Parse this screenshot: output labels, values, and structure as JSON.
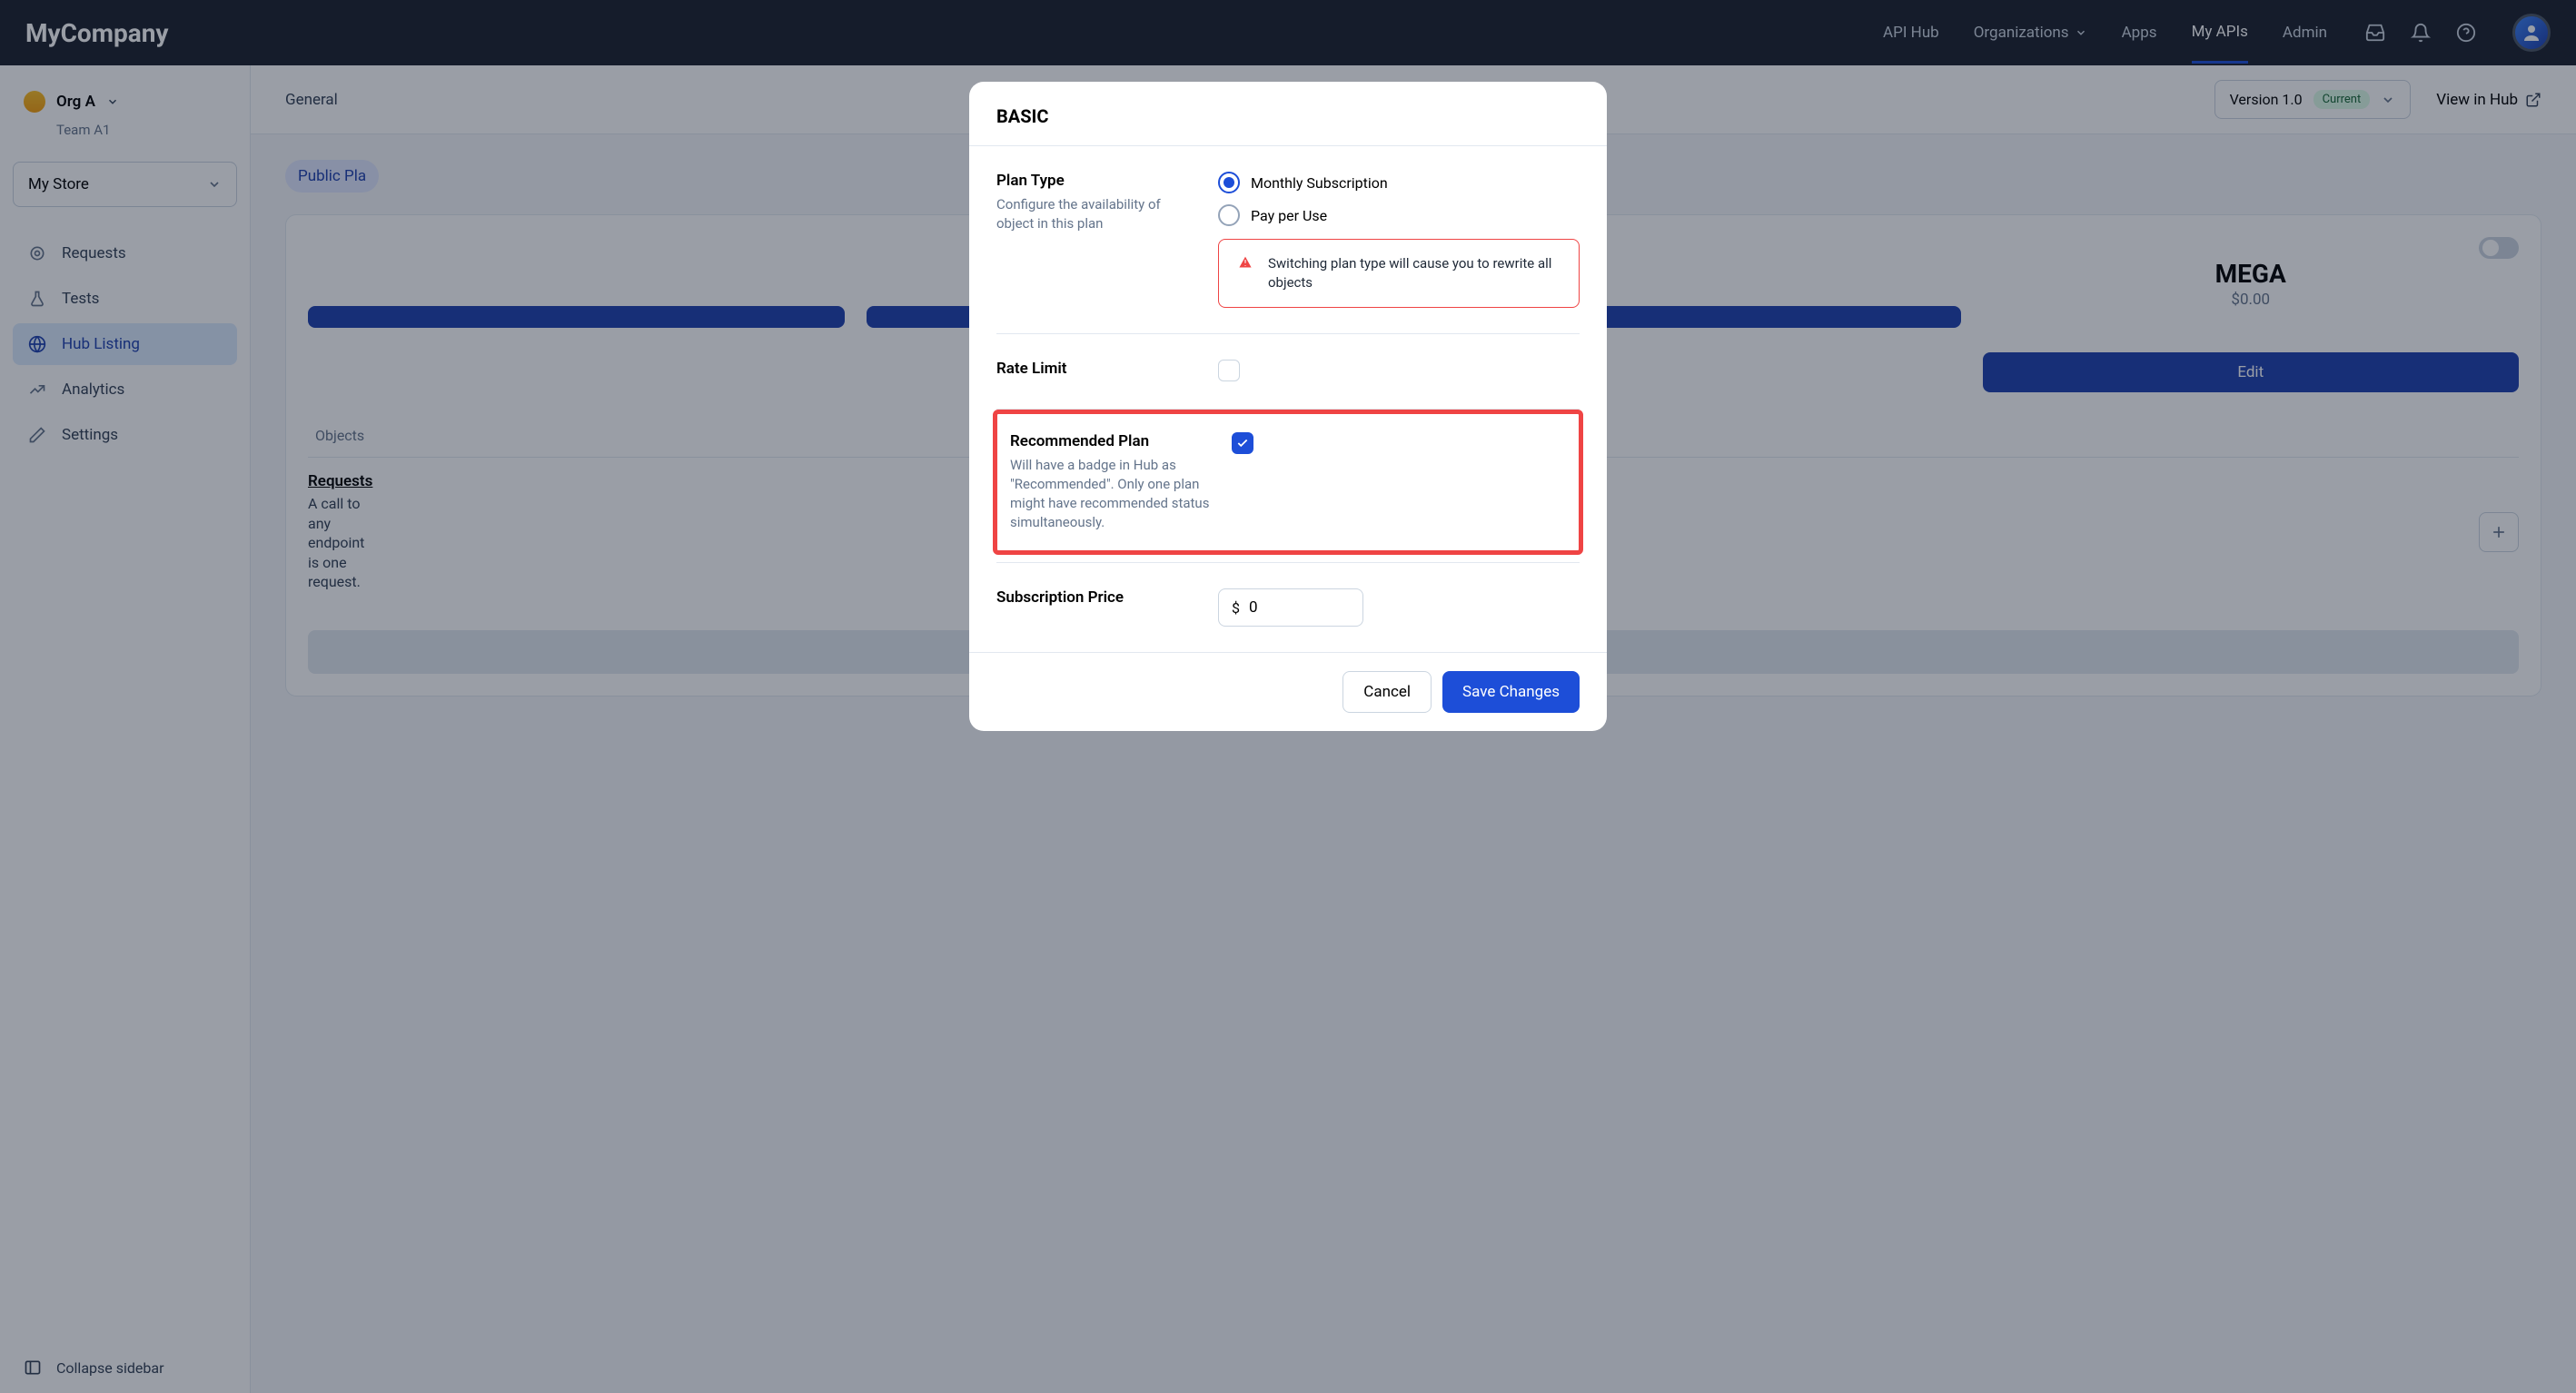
{
  "topnav": {
    "logo": "MyCompany",
    "links": {
      "api_hub": "API Hub",
      "organizations": "Organizations",
      "apps": "Apps",
      "my_apis": "My APIs",
      "admin": "Admin"
    }
  },
  "sidebar": {
    "org_name": "Org A",
    "team_name": "Team A1",
    "store_select": "My Store",
    "items": {
      "requests": "Requests",
      "tests": "Tests",
      "hub_listing": "Hub Listing",
      "analytics": "Analytics",
      "settings": "Settings"
    },
    "collapse": "Collapse sidebar"
  },
  "main": {
    "tabs": {
      "general": "General"
    },
    "version": {
      "label": "Version 1.0",
      "badge": "Current"
    },
    "view_hub": "View in Hub",
    "public_pill": "Public Pla",
    "plans": {
      "mega": {
        "name": "MEGA",
        "price": "$0.00",
        "edit": "Edit"
      }
    },
    "content_tabs": {
      "objects": "Objects"
    },
    "requests_obj": {
      "title": "Requests",
      "desc": "A call to any endpoint is one request."
    },
    "add_object": "Add Object"
  },
  "modal": {
    "title": "BASIC",
    "plan_type": {
      "title": "Plan Type",
      "desc": "Configure the availability of object in this plan",
      "opt_monthly": "Monthly Subscription",
      "opt_payperuse": "Pay per Use",
      "warning": "Switching plan type will cause you to rewrite all objects"
    },
    "rate_limit": {
      "title": "Rate Limit"
    },
    "recommended": {
      "title": "Recommended Plan",
      "desc": "Will have a badge in Hub as \"Recommended\". Only one plan might have recommended status simultaneously."
    },
    "subscription_price": {
      "title": "Subscription Price",
      "currency": "$",
      "value": "0"
    },
    "cancel": "Cancel",
    "save": "Save Changes"
  }
}
